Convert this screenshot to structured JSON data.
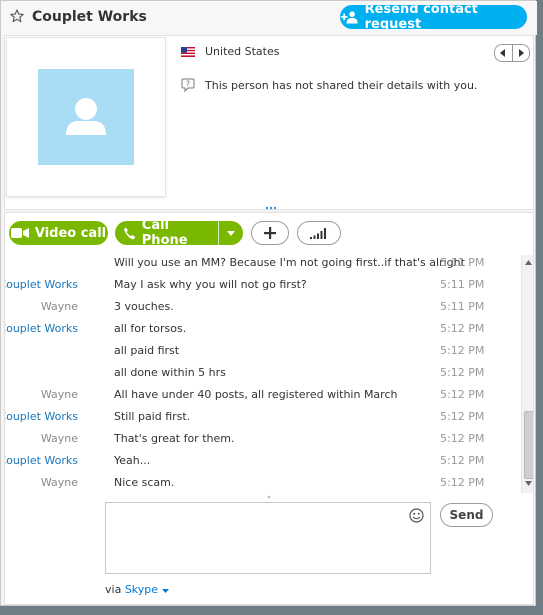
{
  "header": {
    "contact_name": "Couplet Works",
    "resend_button_label": "Resend contact request"
  },
  "profile": {
    "country": "United States",
    "privacy_note": "This person has not shared their details with you."
  },
  "actions": {
    "video_call_label": "Video call",
    "call_phone_label": "Call Phone"
  },
  "messages": [
    {
      "sender": "",
      "text": "Will you use an MM? Because I'm not going first..if that's alright",
      "time": "5:11 PM"
    },
    {
      "sender": "Couplet Works",
      "text": "May I ask why you will not go first?",
      "time": "5:11 PM"
    },
    {
      "sender": "Wayne",
      "text": "3 vouches.",
      "time": "5:11 PM"
    },
    {
      "sender": "Couplet Works",
      "text": "all for torsos.",
      "time": "5:12 PM"
    },
    {
      "sender": "",
      "text": "all paid first",
      "time": "5:12 PM"
    },
    {
      "sender": "",
      "text": "all done within 5 hrs",
      "time": "5:12 PM"
    },
    {
      "sender": "Wayne",
      "text": "All have under 40 posts, all registered within March",
      "time": "5:12 PM"
    },
    {
      "sender": "Couplet Works",
      "text": "Still paid first.",
      "time": "5:12 PM"
    },
    {
      "sender": "Wayne",
      "text": "That's great for them.",
      "time": "5:12 PM"
    },
    {
      "sender": "Couplet Works",
      "text": "Yeah...",
      "time": "5:12 PM"
    },
    {
      "sender": "Wayne",
      "text": "Nice scam.",
      "time": "5:12 PM"
    }
  ],
  "compose": {
    "send_label": "Send",
    "via_prefix": "via",
    "via_service": "Skype"
  },
  "colors": {
    "skype_blue": "#00aff0",
    "call_green": "#7ab800",
    "contact_sender": "#1a76b8",
    "self_sender": "#8a8a8a"
  }
}
